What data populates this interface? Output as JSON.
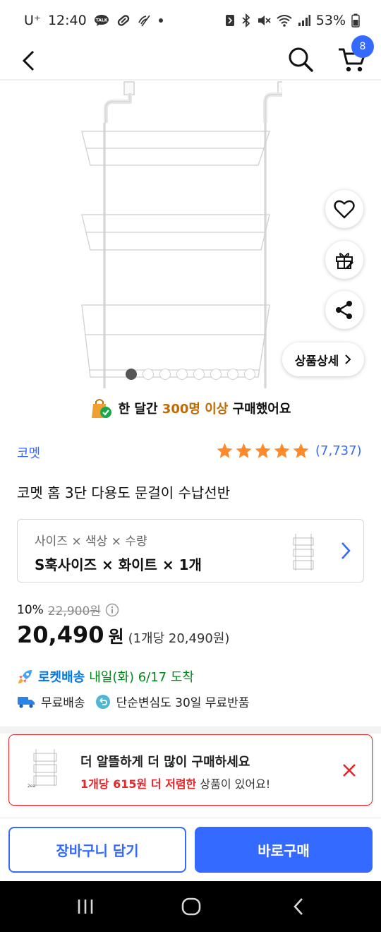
{
  "status": {
    "carrier": "U⁺",
    "time": "12:40",
    "battery": "53%",
    "icons": [
      "talk-icon",
      "pill-icon",
      "signal-slash-icon",
      "dot-icon",
      "nfc-icon",
      "bluetooth-icon",
      "mute-icon",
      "wifi-icon",
      "cell-signal-icon",
      "battery-icon"
    ]
  },
  "nav": {
    "cart_count": "8",
    "icons": [
      "back-arrow-icon",
      "search-icon",
      "cart-icon"
    ]
  },
  "image": {
    "alt": "3단 흰색 문걸이 수납선반",
    "page_count": 8,
    "active_index": 0,
    "float_icons": [
      "heart-icon",
      "gift-icon",
      "share-icon"
    ],
    "detail_label": "상품상세"
  },
  "purchase_banner": {
    "pre": "한 달간 ",
    "highlight": "300명 이상",
    "post": " 구매했어요"
  },
  "product": {
    "brand": "코멧",
    "rating": 5,
    "review_count": "(7,737)",
    "title": "코멧 홈 3단 다용도 문걸이 수납선반"
  },
  "option": {
    "label": "사이즈 × 색상 × 수량",
    "value": "S훅사이즈 × 화이트 × 1개"
  },
  "price": {
    "discount": "10%",
    "original": "22,900원",
    "sale": "20,490",
    "won": "원",
    "unit": "(1개당 20,490원)"
  },
  "delivery": {
    "rocket_label": "로켓배송",
    "arrival": "내일(화) 6/17 도착",
    "free_shipping": "무료배송",
    "return_policy": "단순변심도 30일 무료반품"
  },
  "upsell": {
    "title": "더 알뜰하게 더 많이 구매하세요",
    "sub_highlight": "1개당 615원 더 저렴한",
    "sub_rest": " 상품이 있어요!",
    "thumb_label": "2ea"
  },
  "actions": {
    "add_to_cart": "장바구니 담기",
    "buy_now": "바로구매"
  },
  "colors": {
    "accent": "#346aff",
    "rocket": "#0077e6",
    "arrival": "#00891a",
    "star": "#ff8a2b",
    "alert": "#e52528"
  }
}
